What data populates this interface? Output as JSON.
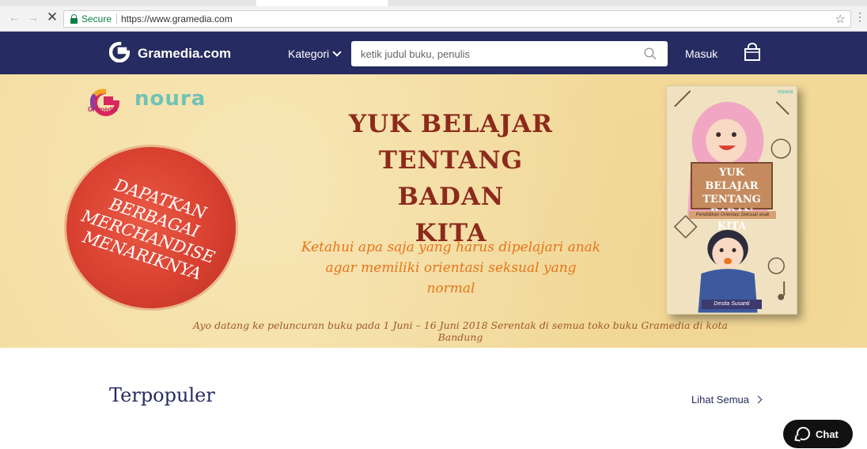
{
  "browser": {
    "secure_label": "Secure",
    "url": "https://www.gramedia.com",
    "icons": [
      "back-icon",
      "forward-icon",
      "stop-icon",
      "lock-icon",
      "star-icon",
      "menu-icon"
    ]
  },
  "header": {
    "logo_text": "Gramedia.com",
    "kategori_label": "Kategori",
    "search_placeholder": "ketik judul buku, penulis",
    "login_label": "Masuk",
    "brand_color": "#262b61"
  },
  "banner": {
    "gramedia_label": "Gramedia",
    "noura_label": "noura",
    "merch_lines": [
      "DAPATKAN",
      "BERBAGAI",
      "MERCHANDISE",
      "MENARIKNYA"
    ],
    "headline_lines": [
      "YUK BELAJAR",
      "TENTANG BADAN",
      "KITA"
    ],
    "subline_lines": [
      "Ketahui apa saja yang harus dipelajari anak",
      "agar memiliki orientasi seksual yang normal"
    ],
    "bottom_text": "Ayo datang ke peluncuran buku pada 1 Juni – 16 Juni 2018 Serentak di semua toko buku Gramedia di kota Bandung",
    "book": {
      "title_lines": [
        "YUK BELAJAR",
        "TENTANG BADAN",
        "KITA"
      ],
      "subtitle": "Pendidikan Orientasi Seksual anak",
      "author": "Desita Susanti",
      "publisher": "noura"
    }
  },
  "content": {
    "section_title": "Terpopuler",
    "see_all_label": "Lihat Semua",
    "chat_label": "Chat"
  }
}
